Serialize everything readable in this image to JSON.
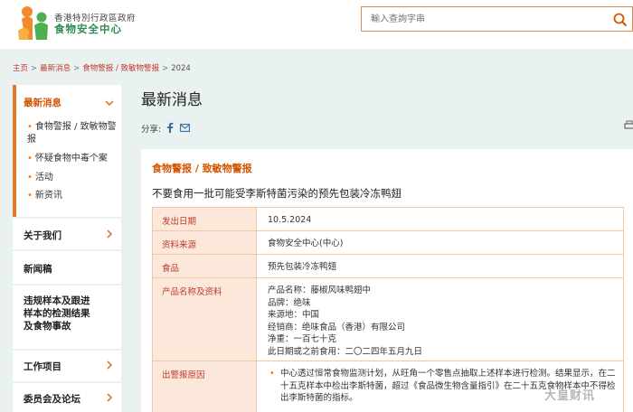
{
  "header": {
    "org_name": "香港特別行政區政府",
    "center_name": "食物安全中心",
    "search_placeholder": "輸入查詢字串"
  },
  "breadcrumb": {
    "items": [
      "主页",
      "最新消息",
      "食物警报 / 致敏物警报",
      "2024"
    ]
  },
  "sidebar": {
    "latest_news": "最新消息",
    "sub_items": [
      "食物警报 / 致敏物警报",
      "怀疑食物中毒个案",
      "活动",
      "新资讯"
    ],
    "about_us": "关于我们",
    "press_releases": "新闻稿",
    "violations": "违规样本及跟进样本的检测结果及食物事故",
    "work_items": "工作项目",
    "committees": "委员会及论坛"
  },
  "main": {
    "page_title": "最新消息",
    "share_label": "分享:",
    "section_heading": "食物警报 / 致敏物警报",
    "article_title": "不要食用一批可能受李斯特菌污染的预先包装冷冻鸭翅",
    "table": {
      "issue_date_label": "发出日期",
      "issue_date_value": "10.5.2024",
      "source_label": "资料来源",
      "source_value": "食物安全中心(中心)",
      "food_label": "食品",
      "food_value": "预先包装冷冻鸭翅",
      "product_label": "产品名称及资料",
      "product_lines": [
        "产品名称：藤椒风味鸭翅中",
        "品牌：绝味",
        "来源地：中国",
        "经销商：绝味食品（香港）有限公司",
        "净重：一百七十克",
        "此日期或之前食用：二〇二四年五月九日"
      ],
      "reason_label": "出警报原因",
      "reason_text": "中心透过恒常食物监测计划，从旺角一个零售点抽取上述样本进行检测。结果显示，在二十五克样本中检出李斯特菌，超过《食品微生物含量指引》在二十五克食物样本中不得检出李斯特菌的指标。"
    }
  },
  "watermark": "大皇财讯",
  "colors": {
    "accent_orange": "#e07a2f",
    "link_red": "#c0392b",
    "brand_green": "#2e8b57",
    "band_bg": "#e9f2f1",
    "table_key_bg": "#fbe8db"
  }
}
